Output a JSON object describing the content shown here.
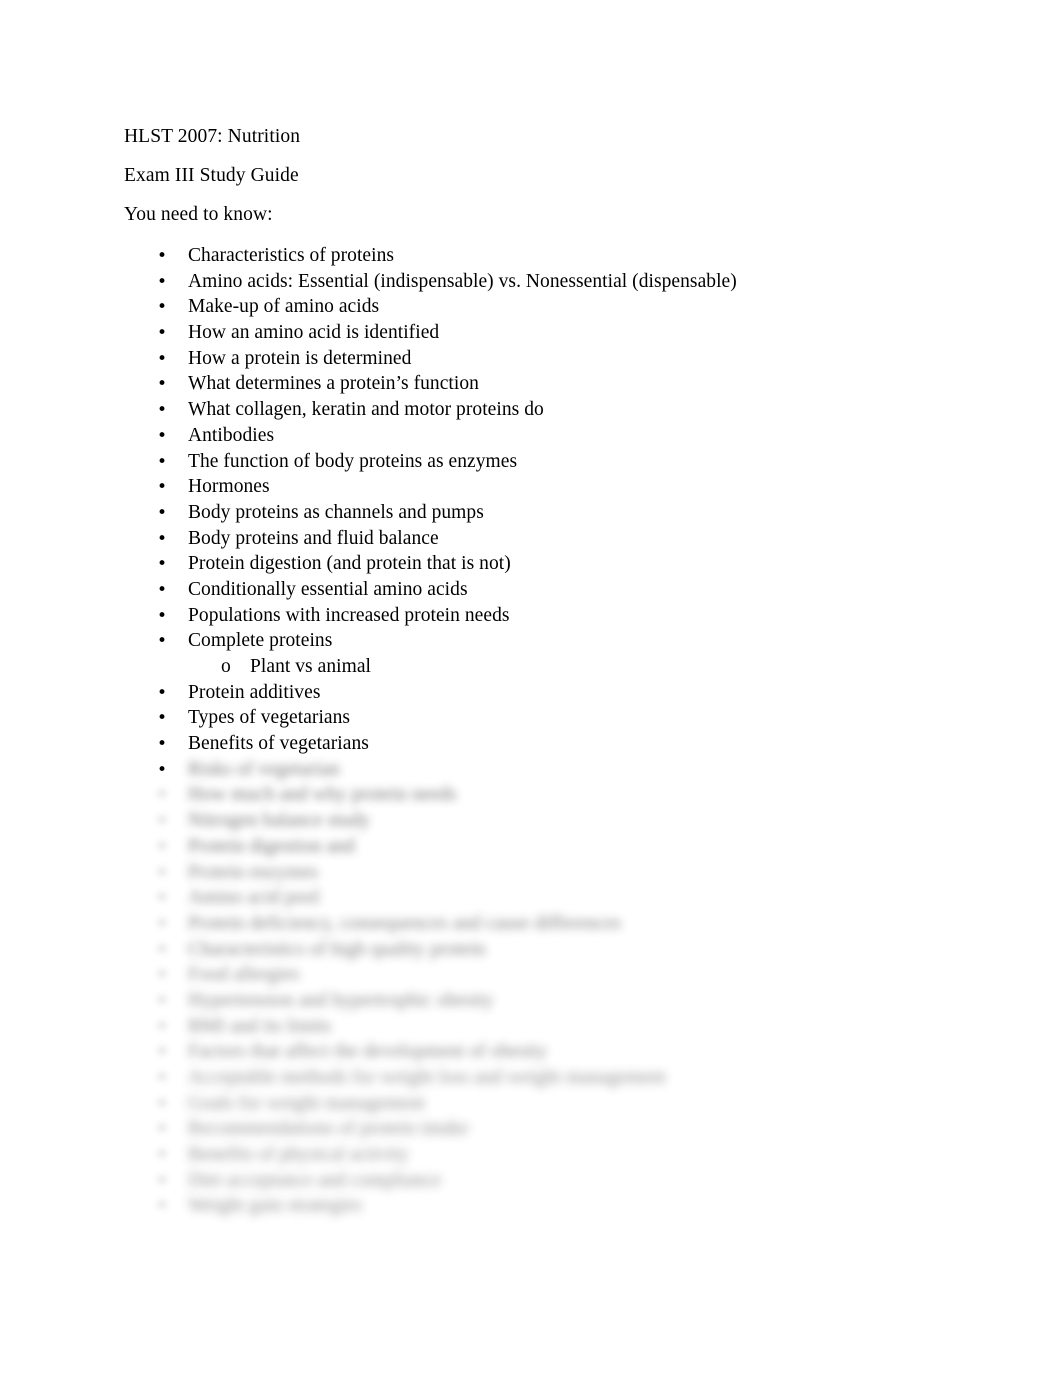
{
  "document": {
    "course_line": "HLST 2007: Nutrition",
    "title_line": "Exam III Study Guide",
    "intro_line": "You need to know:"
  },
  "bullets": [
    {
      "level": 1,
      "marker": "bullet",
      "text": "Characteristics of proteins",
      "legible": true
    },
    {
      "level": 1,
      "marker": "bullet",
      "text": "Amino acids: Essential (indispensable) vs. Nonessential (dispensable)",
      "legible": true
    },
    {
      "level": 1,
      "marker": "bullet",
      "text": "Make-up of amino acids",
      "legible": true
    },
    {
      "level": 1,
      "marker": "bullet",
      "text": "How an amino acid is identified",
      "legible": true
    },
    {
      "level": 1,
      "marker": "bullet",
      "text": "How a protein is determined",
      "legible": true
    },
    {
      "level": 1,
      "marker": "bullet",
      "text": "What determines a protein’s function",
      "legible": true
    },
    {
      "level": 1,
      "marker": "bullet",
      "text": "What collagen, keratin and motor proteins do",
      "legible": true
    },
    {
      "level": 1,
      "marker": "bullet",
      "text": "Antibodies",
      "legible": true
    },
    {
      "level": 1,
      "marker": "bullet",
      "text": "The function of body proteins as enzymes",
      "legible": true
    },
    {
      "level": 1,
      "marker": "bullet",
      "text": "Hormones",
      "legible": true
    },
    {
      "level": 1,
      "marker": "bullet",
      "text": "Body proteins as channels and pumps",
      "legible": true
    },
    {
      "level": 1,
      "marker": "bullet",
      "text": "Body proteins and fluid balance",
      "legible": true
    },
    {
      "level": 1,
      "marker": "bullet",
      "text": "Protein digestion (and protein that is not)",
      "legible": true
    },
    {
      "level": 1,
      "marker": "bullet",
      "text": "Conditionally essential amino acids",
      "legible": true
    },
    {
      "level": 1,
      "marker": "bullet",
      "text": "Populations with increased protein needs",
      "legible": true
    },
    {
      "level": 1,
      "marker": "bullet",
      "text": "Complete proteins",
      "legible": true
    },
    {
      "level": 2,
      "marker": "circle",
      "text": "Plant vs animal",
      "legible": true
    },
    {
      "level": 1,
      "marker": "bullet",
      "text": "Protein additives",
      "legible": true
    },
    {
      "level": 1,
      "marker": "bullet",
      "text": "Types of vegetarians",
      "legible": true
    },
    {
      "level": 1,
      "marker": "bullet",
      "text": "Benefits of vegetarians",
      "legible": true
    },
    {
      "level": 1,
      "marker": "bullet",
      "text": "Risks of vegetarian",
      "legible": false
    },
    {
      "level": 1,
      "marker": "bullet",
      "text": "How much and why protein needs",
      "legible": false
    },
    {
      "level": 1,
      "marker": "bullet",
      "text": "Nitrogen balance study",
      "legible": false
    },
    {
      "level": 1,
      "marker": "bullet",
      "text": "Protein digestion and",
      "legible": false
    },
    {
      "level": 1,
      "marker": "bullet",
      "text": "Protein enzymes",
      "legible": false
    },
    {
      "level": 1,
      "marker": "bullet",
      "text": "Amino acid pool",
      "legible": false
    },
    {
      "level": 1,
      "marker": "bullet",
      "text": "Protein deficiency, consequences and cause differences",
      "legible": false
    },
    {
      "level": 1,
      "marker": "bullet",
      "text": "Characteristics of high quality protein",
      "legible": false
    },
    {
      "level": 1,
      "marker": "bullet",
      "text": "Food allergies",
      "legible": false
    },
    {
      "level": 1,
      "marker": "bullet",
      "text": "Hypertension and hypertrophic obesity",
      "legible": false
    },
    {
      "level": 1,
      "marker": "bullet",
      "text": "BMI and its limits",
      "legible": false
    },
    {
      "level": 1,
      "marker": "bullet",
      "text": "Factors that affect the development of obesity",
      "legible": false
    },
    {
      "level": 1,
      "marker": "bullet",
      "text": "Acceptable methods for weight loss and weight management",
      "legible": false
    },
    {
      "level": 1,
      "marker": "bullet",
      "text": "Goals for weight management",
      "legible": false
    },
    {
      "level": 1,
      "marker": "bullet",
      "text": "Recommendations of protein intake",
      "legible": false
    },
    {
      "level": 1,
      "marker": "bullet",
      "text": "Benefits of physical activity",
      "legible": false
    },
    {
      "level": 1,
      "marker": "bullet",
      "text": "Diet acceptance and compliance",
      "legible": false
    },
    {
      "level": 1,
      "marker": "bullet",
      "text": "Weight gain strategies",
      "legible": false
    }
  ]
}
